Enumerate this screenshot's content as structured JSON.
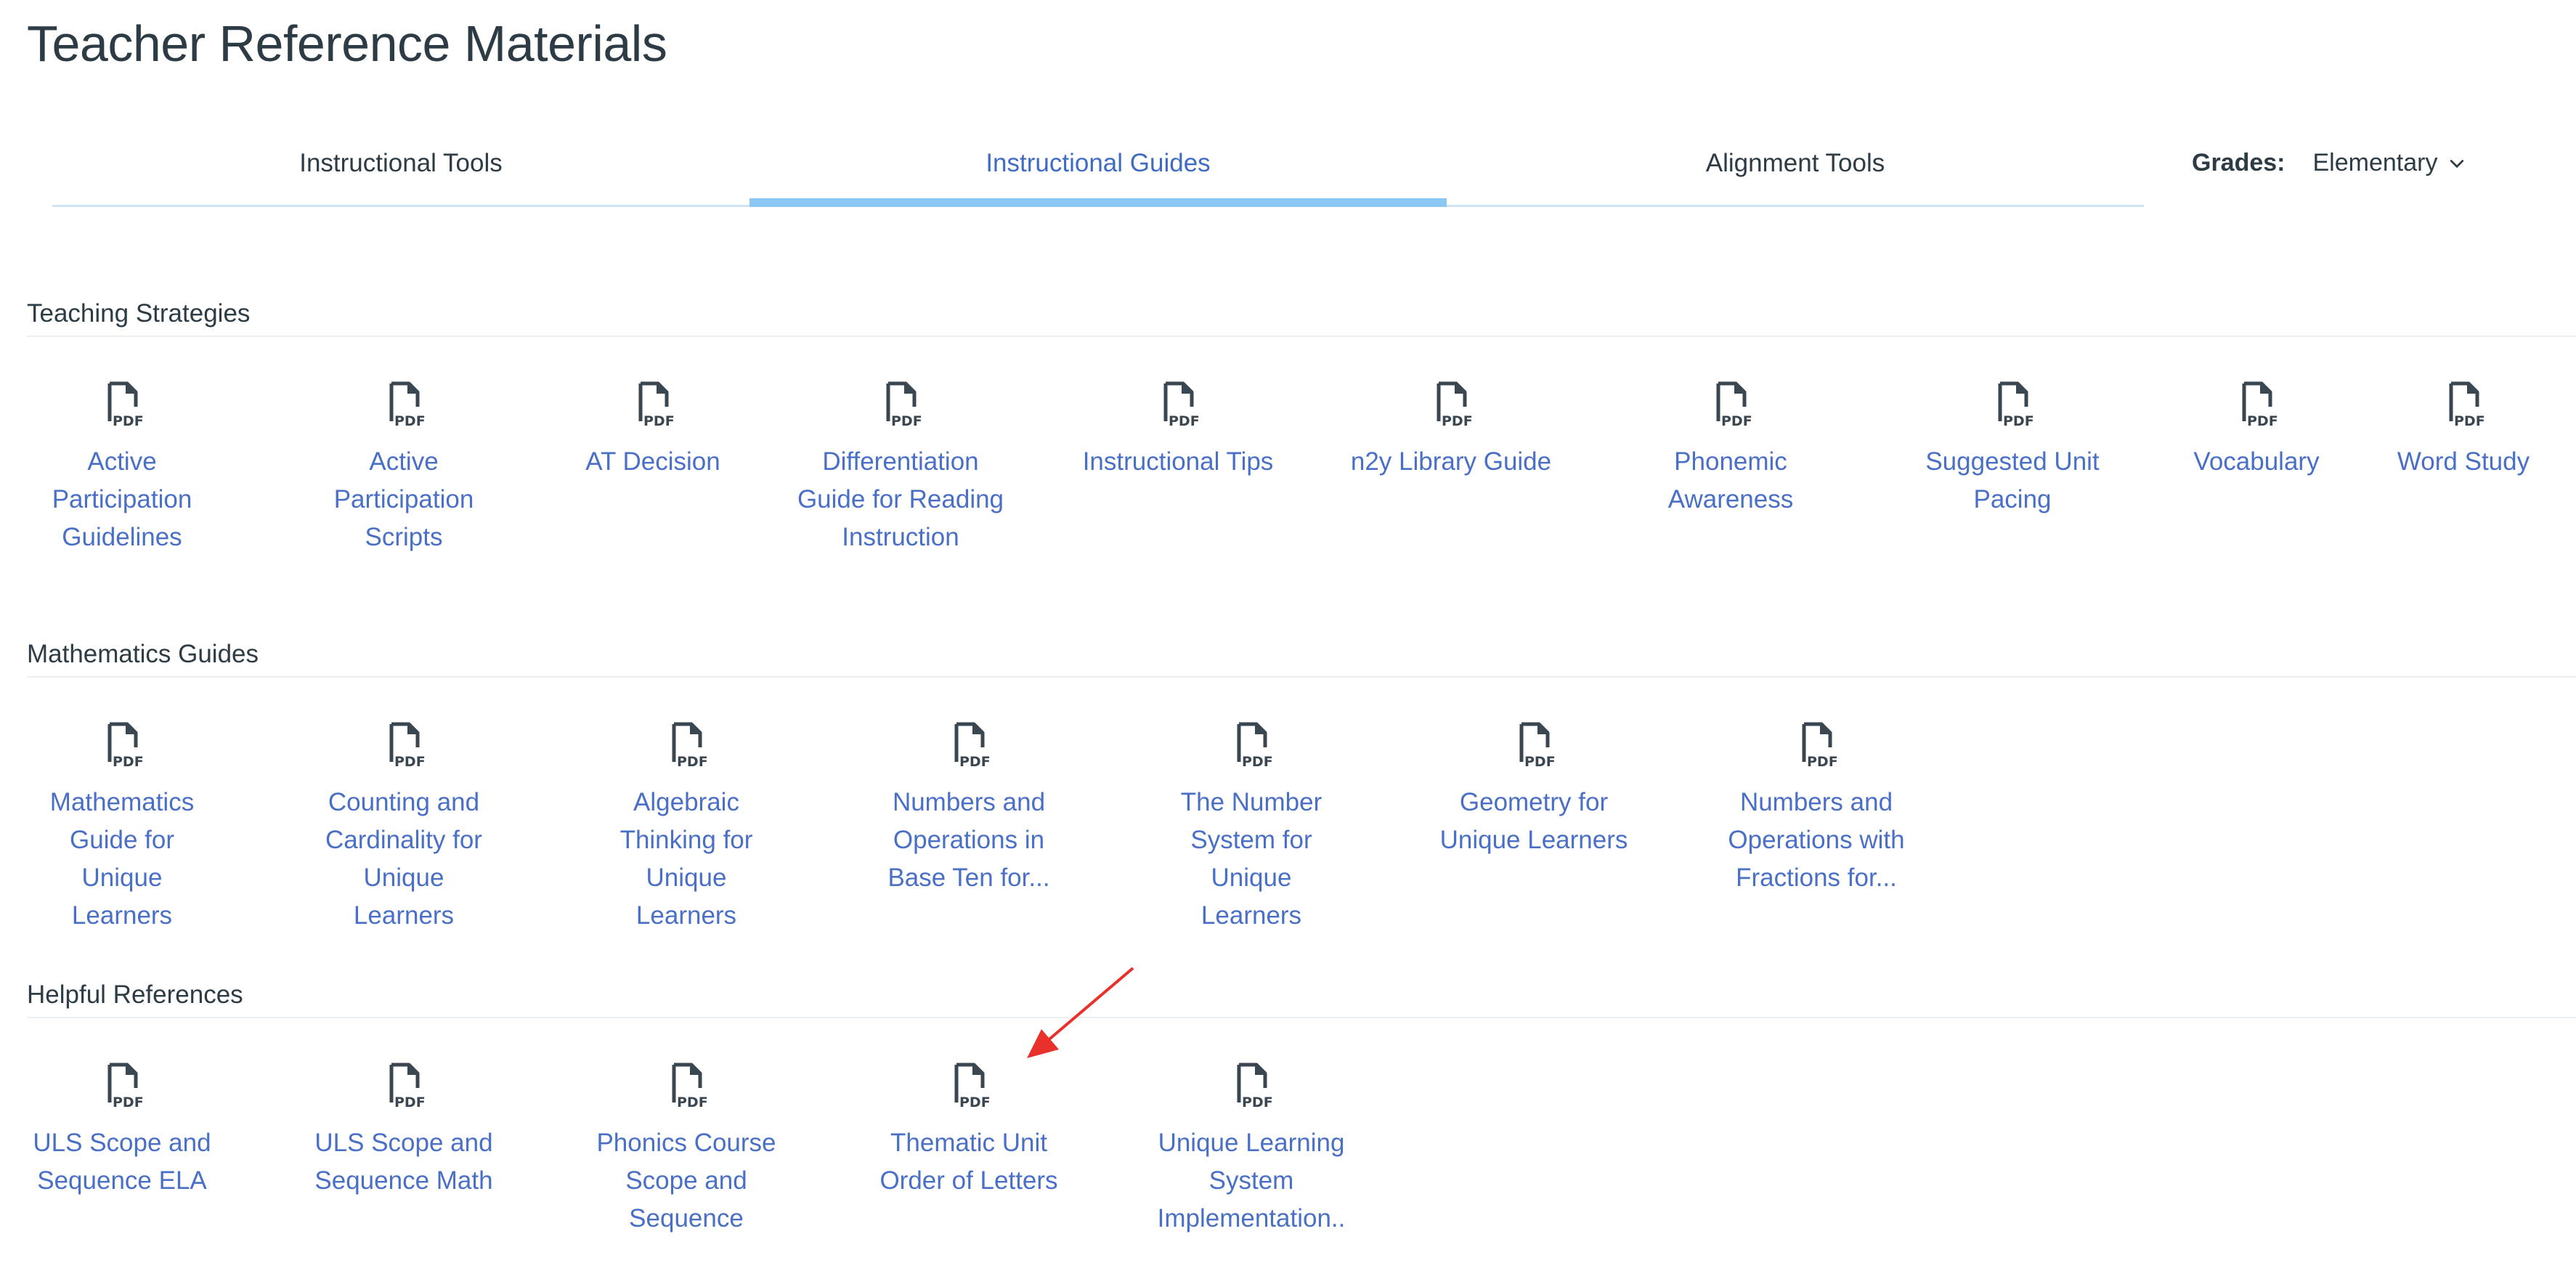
{
  "page_title": "Teacher Reference Materials",
  "tabs": [
    {
      "label": "Instructional Tools",
      "active": false
    },
    {
      "label": "Instructional Guides",
      "active": true
    },
    {
      "label": "Alignment Tools",
      "active": false
    }
  ],
  "grades": {
    "label": "Grades:",
    "value": "Elementary"
  },
  "colors": {
    "link": "#4a6fc6",
    "active_tab": "#3f6cc2",
    "tab_underline": "#8cc6f3",
    "annotation_arrow": "#e8312a"
  },
  "icon": "pdf-file-icon",
  "sections": [
    {
      "title": "Teaching Strategies",
      "items": [
        "Active Participation Guidelines",
        "Active Participation Scripts",
        "AT Decision",
        "Differentiation Guide for Reading Instruction",
        "Instructional Tips",
        "n2y Library Guide",
        "Phonemic Awareness",
        "Suggested Unit Pacing",
        "Vocabulary",
        "Word Study"
      ]
    },
    {
      "title": "Mathematics Guides",
      "items": [
        "Mathematics Guide for Unique Learners",
        "Counting and Cardinality for Unique Learners",
        "Algebraic Thinking for Unique Learners",
        "Numbers and Operations in Base Ten for...",
        "The Number System for Unique Learners",
        "Geometry for Unique Learners",
        "Numbers and Operations with Fractions for..."
      ]
    },
    {
      "title": "Helpful References",
      "items": [
        "ULS Scope and Sequence ELA",
        "ULS Scope and Sequence Math",
        "Phonics Course Scope and Sequence",
        "Thematic Unit Order of Letters",
        "Unique Learning System Implementation.."
      ]
    }
  ]
}
